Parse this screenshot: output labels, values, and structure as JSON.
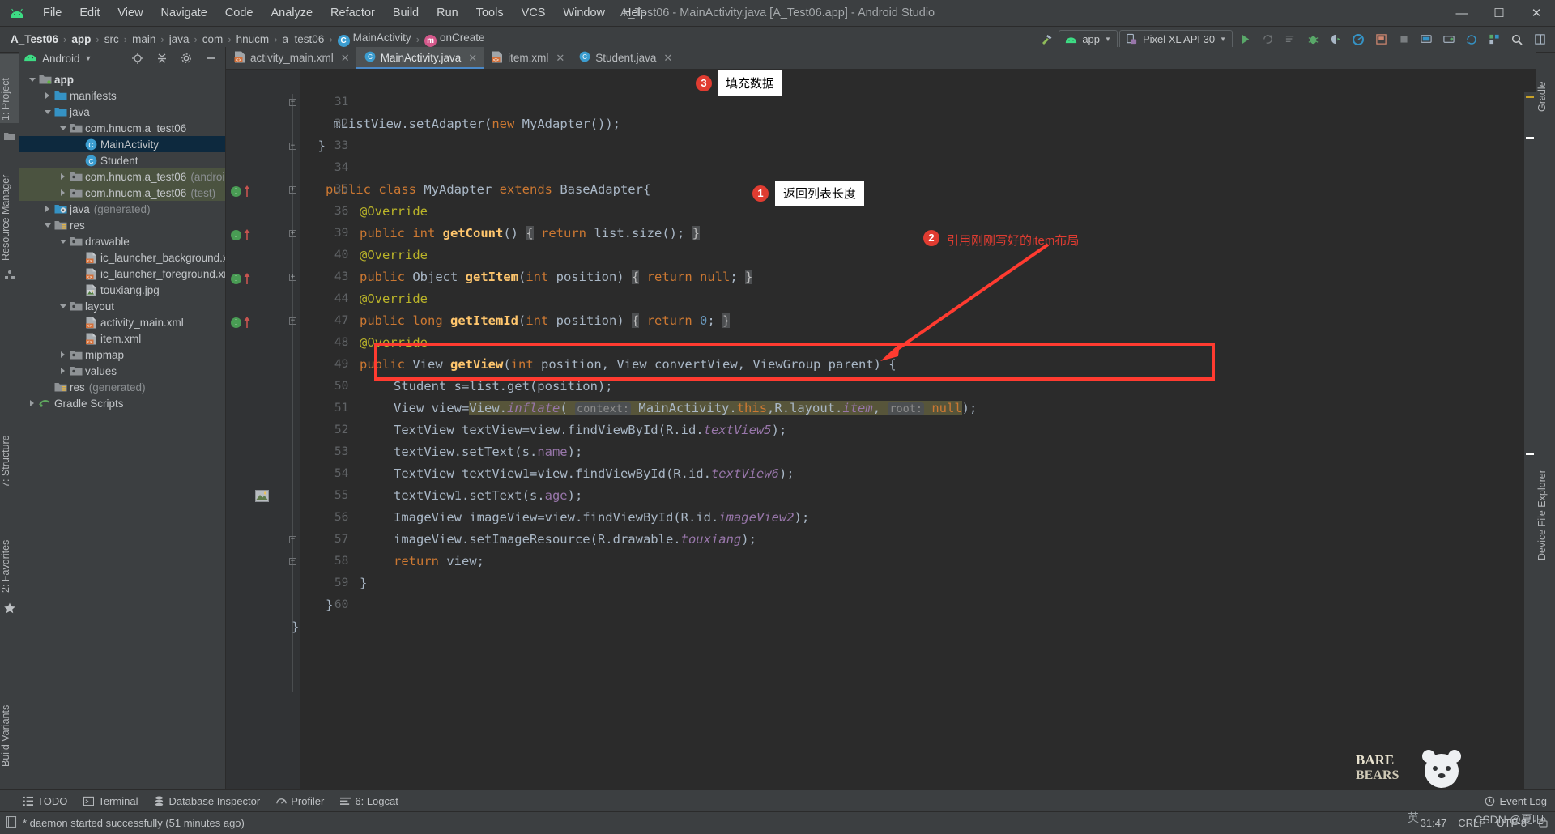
{
  "window": {
    "title": "A_Test06 - MainActivity.java [A_Test06.app] - Android Studio",
    "logo_icon": "android-logo-icon",
    "minimize_icon": "minimize-icon",
    "maximize_icon": "maximize-icon",
    "close_icon": "close-icon"
  },
  "menu": {
    "items": [
      "File",
      "Edit",
      "View",
      "Navigate",
      "Code",
      "Analyze",
      "Refactor",
      "Build",
      "Run",
      "Tools",
      "VCS",
      "Window",
      "Help"
    ]
  },
  "breadcrumb": {
    "items": [
      {
        "label": "A_Test06",
        "bold": true,
        "icon": ""
      },
      {
        "label": "app",
        "bold": true,
        "icon": ""
      },
      {
        "label": "src",
        "bold": false,
        "icon": ""
      },
      {
        "label": "main",
        "bold": false,
        "icon": ""
      },
      {
        "label": "java",
        "bold": false,
        "icon": ""
      },
      {
        "label": "com",
        "bold": false,
        "icon": ""
      },
      {
        "label": "hnucm",
        "bold": false,
        "icon": ""
      },
      {
        "label": "a_test06",
        "bold": false,
        "icon": ""
      },
      {
        "label": "MainActivity",
        "bold": false,
        "icon": "class-icon",
        "icon_letter": "C"
      },
      {
        "label": "onCreate",
        "bold": false,
        "icon": "method-icon",
        "icon_letter": "m"
      }
    ]
  },
  "toolbar": {
    "hammer_icon": "build-hammer-icon",
    "module_selector": "app",
    "module_icon": "android-head-icon",
    "device_selector": "Pixel XL API 30",
    "device_icon": "device-phone-icon",
    "run_icon": "run-play-icon",
    "rerun_icon": "rerun-icon",
    "apply_changes_icon": "apply-changes-icon",
    "debug_icon": "debug-bug-icon",
    "attach_debugger_icon": "attach-debugger-icon",
    "profiler_icon": "profiler-icon",
    "layout_inspector_icon": "layout-inspector-icon",
    "stop_icon": "stop-icon",
    "avd_manager_icon": "avd-manager-icon",
    "sdk_manager_icon": "sdk-manager-icon",
    "sync_gradle_icon": "sync-gradle-icon",
    "project_structure_icon": "project-structure-icon",
    "search_icon": "search-icon",
    "more_icon": "more-icon"
  },
  "left_strip": {
    "items": [
      {
        "label": "1: Project",
        "selected": true,
        "name": "tool-window-project"
      },
      {
        "label": "Resource Manager",
        "selected": false,
        "name": "tool-window-resource-manager"
      },
      {
        "label": "7: Structure",
        "selected": false,
        "name": "tool-window-structure"
      },
      {
        "label": "2: Favorites",
        "selected": false,
        "name": "tool-window-favorites"
      },
      {
        "label": "Build Variants",
        "selected": false,
        "name": "tool-window-build-variants"
      }
    ]
  },
  "right_strip": {
    "items": [
      {
        "label": "Gradle",
        "name": "tool-window-gradle"
      },
      {
        "label": "Device File Explorer",
        "name": "tool-window-device-file-explorer"
      }
    ]
  },
  "project_panel": {
    "title": "Android",
    "android_icon": "android-head-icon",
    "caret_icon": "chevron-down-icon",
    "locate_icon": "locate-target-icon",
    "collapse_icon": "collapse-all-icon",
    "settings_icon": "gear-icon",
    "hide_icon": "hide-minus-icon",
    "tree": [
      {
        "indent": 0,
        "twisty": "down",
        "icon": "module-folder-icon",
        "label": "app",
        "suffix": "",
        "bold": true,
        "state": "normal"
      },
      {
        "indent": 1,
        "twisty": "right",
        "icon": "folder-icon",
        "label": "manifests",
        "suffix": "",
        "bold": false,
        "state": "normal"
      },
      {
        "indent": 1,
        "twisty": "down",
        "icon": "folder-icon",
        "label": "java",
        "suffix": "",
        "bold": false,
        "state": "normal"
      },
      {
        "indent": 2,
        "twisty": "down",
        "icon": "package-icon",
        "label": "com.hnucm.a_test06",
        "suffix": "",
        "bold": false,
        "state": "normal"
      },
      {
        "indent": 3,
        "twisty": "none",
        "icon": "class-icon",
        "label": "MainActivity",
        "suffix": "",
        "bold": false,
        "state": "selected"
      },
      {
        "indent": 3,
        "twisty": "none",
        "icon": "class-icon",
        "label": "Student",
        "suffix": "",
        "bold": false,
        "state": "normal"
      },
      {
        "indent": 2,
        "twisty": "right",
        "icon": "package-icon",
        "label": "com.hnucm.a_test06",
        "suffix": "(androidTest)",
        "bold": false,
        "state": "green"
      },
      {
        "indent": 2,
        "twisty": "right",
        "icon": "package-icon",
        "label": "com.hnucm.a_test06",
        "suffix": "(test)",
        "bold": false,
        "state": "green"
      },
      {
        "indent": 1,
        "twisty": "right",
        "icon": "generated-folder-icon",
        "label": "java",
        "suffix": "(generated)",
        "bold": false,
        "state": "normal"
      },
      {
        "indent": 1,
        "twisty": "down",
        "icon": "res-folder-icon",
        "label": "res",
        "suffix": "",
        "bold": false,
        "state": "normal"
      },
      {
        "indent": 2,
        "twisty": "down",
        "icon": "package-icon",
        "label": "drawable",
        "suffix": "",
        "bold": false,
        "state": "normal"
      },
      {
        "indent": 3,
        "twisty": "none",
        "icon": "xml-file-icon",
        "label": "ic_launcher_background.xml",
        "suffix": "",
        "bold": false,
        "state": "normal"
      },
      {
        "indent": 3,
        "twisty": "none",
        "icon": "xml-file-icon",
        "label": "ic_launcher_foreground.xml",
        "suffix": "",
        "bold": false,
        "state": "normal"
      },
      {
        "indent": 3,
        "twisty": "none",
        "icon": "image-file-icon",
        "label": "touxiang.jpg",
        "suffix": "",
        "bold": false,
        "state": "normal"
      },
      {
        "indent": 2,
        "twisty": "down",
        "icon": "package-icon",
        "label": "layout",
        "suffix": "",
        "bold": false,
        "state": "normal"
      },
      {
        "indent": 3,
        "twisty": "none",
        "icon": "xml-file-icon",
        "label": "activity_main.xml",
        "suffix": "",
        "bold": false,
        "state": "normal"
      },
      {
        "indent": 3,
        "twisty": "none",
        "icon": "xml-file-icon",
        "label": "item.xml",
        "suffix": "",
        "bold": false,
        "state": "normal"
      },
      {
        "indent": 2,
        "twisty": "right",
        "icon": "package-icon",
        "label": "mipmap",
        "suffix": "",
        "bold": false,
        "state": "normal"
      },
      {
        "indent": 2,
        "twisty": "right",
        "icon": "package-icon",
        "label": "values",
        "suffix": "",
        "bold": false,
        "state": "normal"
      },
      {
        "indent": 1,
        "twisty": "none",
        "icon": "res-folder-icon",
        "label": "res",
        "suffix": "(generated)",
        "bold": false,
        "state": "normal"
      },
      {
        "indent": 0,
        "twisty": "right",
        "icon": "gradle-icon",
        "label": "Gradle Scripts",
        "suffix": "",
        "bold": false,
        "state": "normal"
      }
    ]
  },
  "editor": {
    "tabs": [
      {
        "label": "activity_main.xml",
        "icon": "xml-file-icon",
        "active": false,
        "closable": true
      },
      {
        "label": "MainActivity.java",
        "icon": "class-icon",
        "active": true,
        "closable": true
      },
      {
        "label": "item.xml",
        "icon": "xml-file-icon",
        "active": false,
        "closable": true
      },
      {
        "label": "Student.java",
        "icon": "class-icon",
        "active": false,
        "closable": true
      }
    ],
    "lines": [
      {
        "num": "31",
        "fold": "",
        "gutter": "",
        "indent": 0
      },
      {
        "num": "32",
        "fold": "end",
        "gutter": "",
        "indent": 0
      },
      {
        "num": "33",
        "fold": "",
        "gutter": "",
        "indent": 0
      },
      {
        "num": "34",
        "fold": "start",
        "gutter": "",
        "indent": 0
      },
      {
        "num": "35",
        "fold": "",
        "gutter": "",
        "indent": 0
      },
      {
        "num": "36",
        "fold": "plus",
        "gutter": "override",
        "indent": 0
      },
      {
        "num": "39",
        "fold": "",
        "gutter": "",
        "indent": 0
      },
      {
        "num": "40",
        "fold": "plus",
        "gutter": "override",
        "indent": 0
      },
      {
        "num": "43",
        "fold": "",
        "gutter": "",
        "indent": 0
      },
      {
        "num": "44",
        "fold": "plus",
        "gutter": "override",
        "indent": 0
      },
      {
        "num": "47",
        "fold": "",
        "gutter": "",
        "indent": 0
      },
      {
        "num": "48",
        "fold": "start",
        "gutter": "override",
        "indent": 0
      },
      {
        "num": "49",
        "fold": "",
        "gutter": "",
        "indent": 0
      },
      {
        "num": "50",
        "fold": "",
        "gutter": "",
        "indent": 0
      },
      {
        "num": "51",
        "fold": "",
        "gutter": "",
        "indent": 0
      },
      {
        "num": "52",
        "fold": "",
        "gutter": "",
        "indent": 0
      },
      {
        "num": "53",
        "fold": "",
        "gutter": "",
        "indent": 0
      },
      {
        "num": "54",
        "fold": "",
        "gutter": "",
        "indent": 0
      },
      {
        "num": "55",
        "fold": "",
        "gutter": "",
        "indent": 0
      },
      {
        "num": "56",
        "fold": "",
        "gutter": "image",
        "indent": 0
      },
      {
        "num": "57",
        "fold": "",
        "gutter": "",
        "indent": 0
      },
      {
        "num": "58",
        "fold": "end",
        "gutter": "",
        "indent": 0
      },
      {
        "num": "59",
        "fold": "end",
        "gutter": "",
        "indent": 0
      },
      {
        "num": "60",
        "fold": "",
        "gutter": "",
        "indent": 0
      }
    ],
    "code_text": {
      "l31": "mListView.setAdapter(new MyAdapter());",
      "l32": "}",
      "l34": "public class MyAdapter extends BaseAdapter{",
      "l35": "@Override",
      "l36": "public int getCount() { return list.size(); }",
      "l39": "@Override",
      "l40": "public Object getItem(int position) { return null; }",
      "l43": "@Override",
      "l44": "public long getItemId(int position) { return 0; }",
      "l47": "@Override",
      "l48": "public View getView(int position, View convertView, ViewGroup parent) {",
      "l49": "Student s=list.get(position);",
      "l50": "View view=View.inflate( context: MainActivity.this,R.layout.item, root: null);",
      "l51": "TextView textView=view.findViewById(R.id.textView5);",
      "l52": "textView.setText(s.name);",
      "l53": "TextView textView1=view.findViewById(R.id.textView6);",
      "l54": "textView1.setText(s.age);",
      "l55": "ImageView imageView=view.findViewById(R.id.imageView2);",
      "l56": "imageView.setImageResource(R.drawable.touxiang);",
      "l57": "return view;",
      "l58": "}",
      "l59": "}",
      "l60": "}"
    }
  },
  "annotations": [
    {
      "id": "1",
      "number": "1",
      "label": "返回列表长度",
      "type": "box"
    },
    {
      "id": "2",
      "number": "2",
      "label": "引用刚刚写好的item布局",
      "type": "text"
    },
    {
      "id": "3",
      "number": "3",
      "label": "填充数据",
      "type": "box"
    }
  ],
  "bottom_tools": {
    "items": [
      {
        "label": "TODO",
        "icon": "todo-list-icon"
      },
      {
        "label": "Terminal",
        "icon": "terminal-icon"
      },
      {
        "label": "Database Inspector",
        "icon": "database-icon"
      },
      {
        "label": "Profiler",
        "icon": "profiler-icon"
      },
      {
        "label": "6: Logcat",
        "icon": "logcat-icon"
      }
    ],
    "event_log": "Event Log",
    "event_log_icon": "event-log-icon",
    "layout_editor_icon": "layout-editor-icon"
  },
  "status_bar": {
    "message": "* daemon started successfully (51 minutes ago)",
    "message_icon": "console-icon",
    "caret_position": "31:47",
    "line_separator": "CRLF",
    "encoding": "UTF-8",
    "lock_icon": "lock-icon",
    "ime_indicator": "英",
    "watermark": "CSDN @夏吧"
  }
}
